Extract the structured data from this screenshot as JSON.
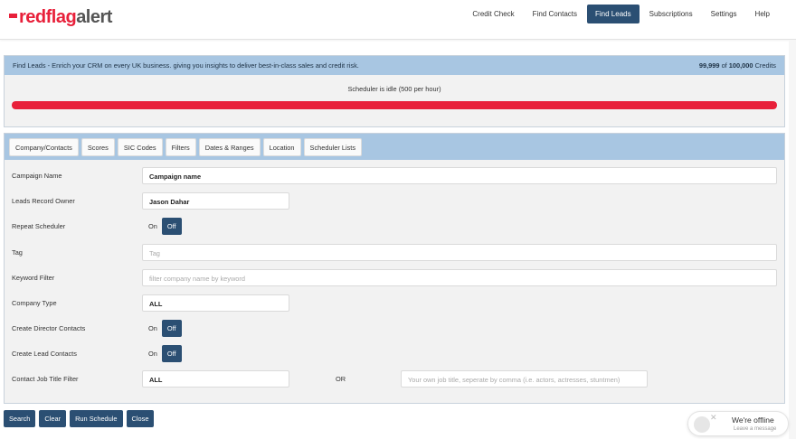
{
  "brand": {
    "part1": "red",
    "part2": "flag",
    "part3": "alert"
  },
  "nav": {
    "items": [
      "Credit Check",
      "Find Contacts",
      "Find Leads",
      "Subscriptions",
      "Settings",
      "Help"
    ],
    "active": "Find Leads"
  },
  "info_panel": {
    "description": "Find Leads - Enrich your CRM on every UK business. giving you insights to deliver best-in-class sales and credit risk.",
    "credits_used": "99,999",
    "credits_of": "of",
    "credits_total": "100,000",
    "credits_label": "Credits",
    "scheduler_status": "Scheduler is idle (500 per hour)",
    "progress_fraction": 1.0,
    "progress_color": "#e8203a"
  },
  "tabs": [
    "Company/Contacts",
    "Scores",
    "SIC Codes",
    "Filters",
    "Dates & Ranges",
    "Location",
    "Scheduler Lists"
  ],
  "form": {
    "campaign_name": {
      "label": "Campaign Name",
      "value": "Campaign name"
    },
    "leads_owner": {
      "label": "Leads Record Owner",
      "value": "Jason Dahar"
    },
    "repeat_scheduler": {
      "label": "Repeat Scheduler",
      "on": "On",
      "off": "Off",
      "selected": "Off"
    },
    "tag": {
      "label": "Tag",
      "placeholder": "Tag"
    },
    "keyword_filter": {
      "label": "Keyword Filter",
      "placeholder": "filter company name by keyword"
    },
    "company_type": {
      "label": "Company Type",
      "value": "ALL"
    },
    "director_contacts": {
      "label": "Create Director Contacts",
      "on": "On",
      "off": "Off",
      "selected": "Off"
    },
    "lead_contacts": {
      "label": "Create Lead Contacts",
      "on": "On",
      "off": "Off",
      "selected": "Off"
    },
    "job_title_filter": {
      "label": "Contact Job Title Filter",
      "value": "ALL",
      "or": "OR",
      "custom_placeholder": "Your own job title, seperate by comma (i.e. actors, actresses, stuntmen)"
    }
  },
  "actions": {
    "search": "Search",
    "clear": "Clear",
    "run_schedule": "Run Schedule",
    "close": "Close"
  },
  "chat": {
    "title": "We're offline",
    "subtitle": "Leave a message",
    "icon": "chat-bubble-icon"
  },
  "colors": {
    "accent": "#2b4f73",
    "brand_red": "#e8203a",
    "panel_header": "#a8c6e2"
  }
}
